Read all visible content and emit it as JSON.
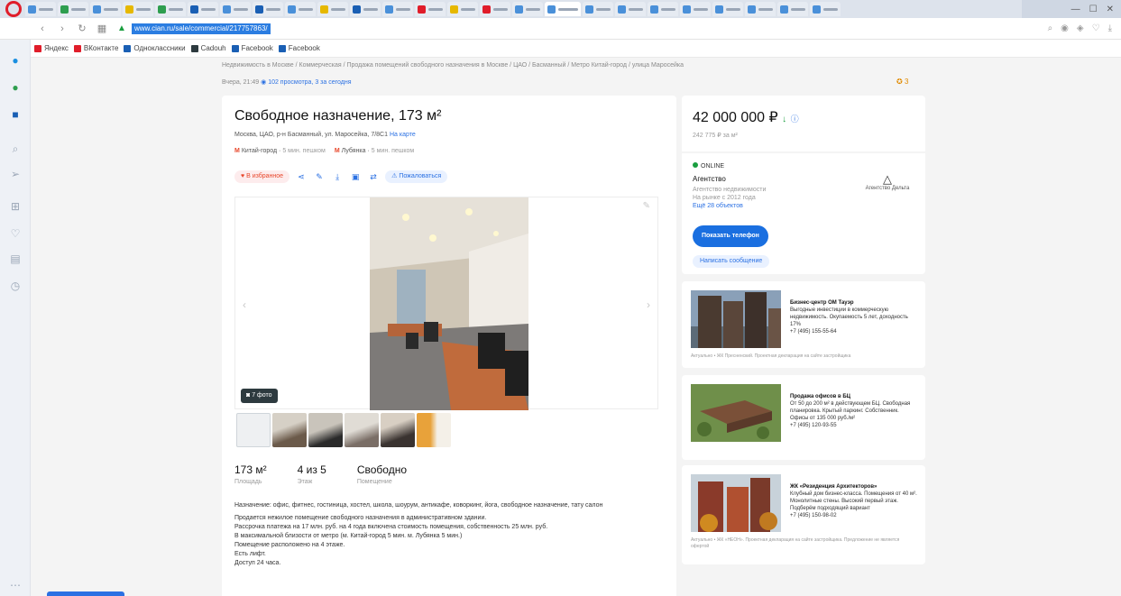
{
  "listing": {
    "title": "Свободное назначение, 173 м²",
    "address": "Москва, ЦАО, р-н Басманный, ул. Маросейка, 7/8С1",
    "address_link": "На карте",
    "metro": [
      {
        "station": "Китай-город",
        "time": "5 мин. пешком"
      },
      {
        "station": "Лубянка",
        "time": "5 мин. пешком"
      }
    ],
    "favorite_label": "В избранное",
    "complain_label": "Пожаловаться",
    "photos_badge": "7 фото",
    "facts": [
      {
        "value": "173 м²",
        "label": "Площадь"
      },
      {
        "value": "4 из 5",
        "label": "Этаж"
      },
      {
        "value": "Свободно",
        "label": "Помещение"
      }
    ],
    "description": [
      "Назначение: офис, фитнес, гостиница, хостел, школа, шоурум, антикафе, коворкинг, йога, свободное назначение, тату салон",
      "Продается нежилое помещение свободного назначения в административном здании.",
      "Рассрочка платежа на 17 млн. руб. на 4 года включена стоимость помещения, собственность 25 млн. руб.",
      "В максимальной близости от метро (м. Китай-город 5 мин. м. Лубянка 5 мин.)",
      "Помещение расположено на 4 этаже.",
      "Есть лифт.",
      "Доступ 24 часа."
    ]
  },
  "page": {
    "breadcrumbs": "Недвижимость в Москве / Коммерческая / Продажа помещений свободного назначения в Москве / ЦАО / Басманный / Метро Китай-город / улица Маросейка",
    "meta": "Вчера, 21:49",
    "meta_views": "102 просмотра, 3 за сегодня",
    "fav_count": "3"
  },
  "price": {
    "value": "42 000 000 ₽",
    "per_m2": "242 775 ₽ за м²"
  },
  "agent": {
    "status": "ONLINE",
    "name": "Агентство",
    "lines": [
      "Агентство недвижимости",
      "На рынке с 2012 года"
    ],
    "link": "Ещё 28 объектов",
    "logo_caption": "Агентство Дельта",
    "phone_button": "Показать телефон",
    "message_button": "Написать сообщение"
  },
  "ads": [
    {
      "title": "Бизнес-центр ОМ Тауэр",
      "text": "Выгодные инвестиции в коммерческую недвижимость. Окупаемость 5 лет, доходность 17%",
      "phone": "+7 (495) 155-55-64",
      "foot": "Актуально • ЖК Пресненский. Проектная декларация на сайте застройщика"
    },
    {
      "title": "Продажа офисов в БЦ",
      "text": "От 50 до 200 м² в действующем БЦ. Свободная планировка. Крытый паркинг. Собственник. Офисы от 135 000 руб./м²",
      "phone": "+7 (495) 120-93-55",
      "foot": ""
    },
    {
      "title": "ЖК «Резиденция Архитекторов»",
      "text": "Клубный дом бизнес-класса. Помещения от 40 м². Монолитные стены. Высокий первый этаж. Подберём подходящий вариант",
      "phone": "+7 (495) 150-98-02",
      "foot": "Актуально • ЖК «НЕОН». Проектная декларация на сайте застройщика. Предложение не является офертой"
    }
  ],
  "browser": {
    "url": "www.cian.ru/sale/commercial/217757863/",
    "bookmarks": [
      "Яндекс",
      "ВКонтакте",
      "Одноклассники",
      "Cadouh",
      "Facebook",
      "Facebook"
    ]
  },
  "colors": {
    "accent": "#1a6fe0",
    "link": "#2b71e3",
    "metro_red": "#e8472b",
    "online_green": "#1a9e3f"
  }
}
